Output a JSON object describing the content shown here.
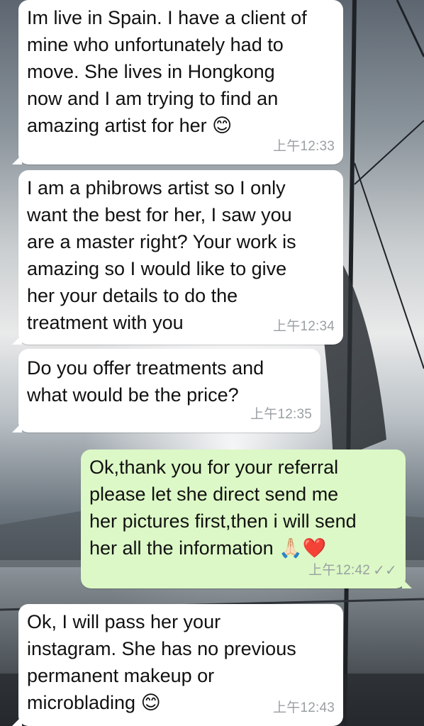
{
  "messages": [
    {
      "direction": "incoming",
      "text": "Im live in Spain. I have a client of\nmine who unfortunately had to\nmove. She lives in Hongkong\nnow and I am trying to find an\namazing artist for her",
      "emoji": "😊",
      "time": "上午12:33"
    },
    {
      "direction": "incoming",
      "text": "I am a phibrows artist so I only\nwant the best for her, I saw you\nare a master right? Your work is\namazing so I would like to give\nher your details to do the\ntreatment with you",
      "emoji": "",
      "time": "上午12:34"
    },
    {
      "direction": "incoming",
      "text": "Do you offer treatments and\nwhat would be the price?",
      "emoji": "",
      "time": "上午12:35"
    },
    {
      "direction": "outgoing",
      "text": "Ok,thank you for your referral\nplease let she direct send me\nher pictures first,then i will send\nher all the information",
      "emoji": "🙏🏻❤️",
      "time": "上午12:42",
      "status": "read-ticks"
    },
    {
      "direction": "incoming",
      "text": "Ok, I will pass her your\ninstagram. She has no previous\npermanent makeup or\nmicroblading",
      "emoji": "😊",
      "time": "上午12:43"
    }
  ],
  "colors": {
    "incoming_bubble": "#ffffff",
    "outgoing_bubble": "#dcf8c6",
    "timestamp": "#9aa0a3"
  }
}
